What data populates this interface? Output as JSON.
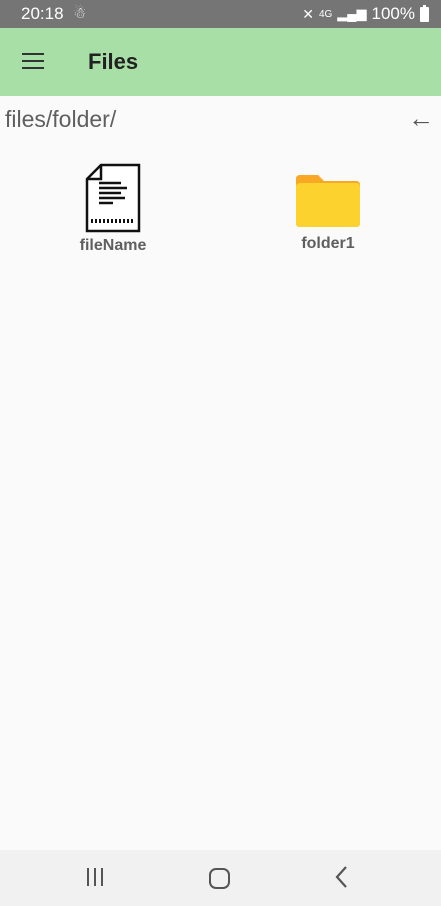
{
  "status_bar": {
    "time": "20:18",
    "notification_icon": "notification-icon",
    "network_label": "4G",
    "battery": "100%"
  },
  "app_bar": {
    "title": "Files",
    "menu_icon": "hamburger-menu-icon",
    "background": "#a8dfa6"
  },
  "path_bar": {
    "path": "files/folder/",
    "back_icon": "arrow-left-icon"
  },
  "items": [
    {
      "name": "fileName",
      "type": "file",
      "icon": "document-icon"
    },
    {
      "name": "folder1",
      "type": "folder",
      "icon": "folder-icon",
      "color": "#fbd22e"
    }
  ],
  "nav_bar": {
    "recents_icon": "recents-icon",
    "home_icon": "home-icon",
    "back_icon": "back-icon"
  }
}
